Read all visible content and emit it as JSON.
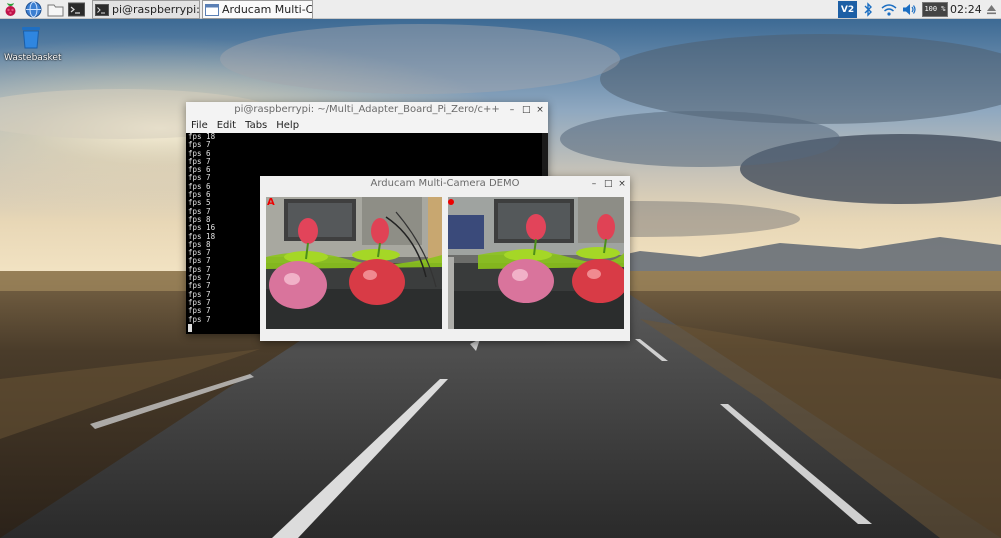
{
  "taskbar": {
    "launchers": [
      {
        "name": "raspberry-menu",
        "icon": "raspberry-icon"
      },
      {
        "name": "web-browser",
        "icon": "globe-icon"
      },
      {
        "name": "file-manager",
        "icon": "folder-icon"
      },
      {
        "name": "terminal",
        "icon": "terminal-icon"
      }
    ],
    "tasks": [
      {
        "label": "pi@raspberrypi: ~/M...",
        "active": false
      },
      {
        "label": "Arducam Multi-Came...",
        "active": true
      }
    ],
    "tray": {
      "vnc_label": "V2",
      "cpu_label": "100 %",
      "clock": "02:24"
    }
  },
  "desktop": {
    "icons": [
      {
        "label": "Wastebasket"
      }
    ]
  },
  "terminal": {
    "title": "pi@raspberrypi: ~/Multi_Adapter_Board_Pi_Zero/c++",
    "menu": [
      "File",
      "Edit",
      "Tabs",
      "Help"
    ],
    "lines": [
      "fps 18",
      "fps 7",
      "fps 6",
      "fps 7",
      "fps 6",
      "fps 7",
      "fps 6",
      "fps 6",
      "fps 5",
      "fps 7",
      "fps 8",
      "fps 16",
      "fps 18",
      "fps 8",
      "fps 7",
      "fps 7",
      "fps 7",
      "fps 7",
      "fps 7",
      "fps 7",
      "fps 7",
      "fps 7",
      "fps 7"
    ]
  },
  "camera_window": {
    "title": "Arducam Multi-Camera DEMO",
    "frames": [
      {
        "label": "A"
      },
      {
        "label": "B"
      }
    ]
  },
  "window_controls": {
    "minimize": "–",
    "maximize": "□",
    "close": "×"
  }
}
